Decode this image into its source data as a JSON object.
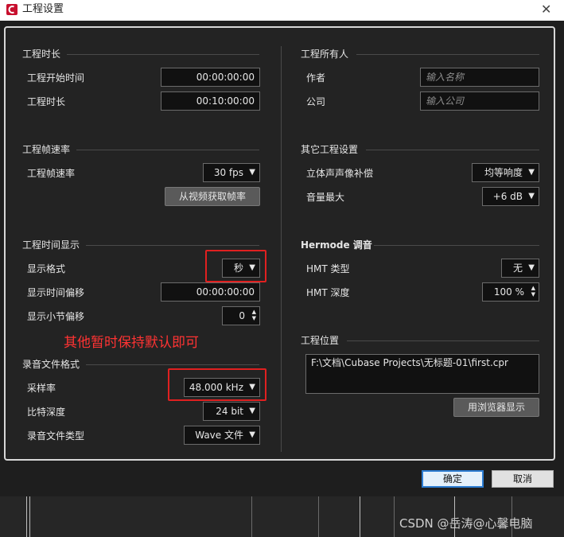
{
  "window": {
    "title": "工程设置",
    "close_glyph": "✕",
    "icon": "cubase-logo-icon"
  },
  "left": {
    "length": {
      "title": "工程时长",
      "start_label": "工程开始时间",
      "start_value": "00:00:00:00",
      "length_label": "工程时长",
      "length_value": "00:10:00:00"
    },
    "framerate": {
      "title": "工程帧速率",
      "rate_label": "工程帧速率",
      "rate_value": "30 fps",
      "from_video_button": "从视频获取帧率"
    },
    "timedisplay": {
      "title": "工程时间显示",
      "format_label": "显示格式",
      "format_value": "秒",
      "offset_label": "显示时间偏移",
      "offset_value": "00:00:00:00",
      "bar_offset_label": "显示小节偏移",
      "bar_offset_value": "0"
    },
    "record": {
      "title": "录音文件格式",
      "samplerate_label": "采样率",
      "samplerate_value": "48.000 kHz",
      "bitdepth_label": "比特深度",
      "bitdepth_value": "24 bit",
      "filetype_label": "录音文件类型",
      "filetype_value": "Wave 文件"
    }
  },
  "right": {
    "owner": {
      "title": "工程所有人",
      "author_label": "作者",
      "author_placeholder": "输入名称",
      "company_label": "公司",
      "company_placeholder": "输入公司"
    },
    "other": {
      "title": "其它工程设置",
      "pan_label": "立体声声像补偿",
      "pan_value": "均等响度",
      "volmax_label": "音量最大",
      "volmax_value": "+6 dB"
    },
    "hermode": {
      "title": "Hermode 调音",
      "type_label": "HMT 类型",
      "type_value": "无",
      "depth_label": "HMT 深度",
      "depth_value": "100 %"
    },
    "location": {
      "title": "工程位置",
      "path": "F:\\文档\\Cubase Projects\\无标题-01\\first.cpr",
      "browser_button": "用浏览器显示"
    }
  },
  "annotation": {
    "note": "其他暂时保持默认即可",
    "highlight_color": "#e02020"
  },
  "dialog": {
    "ok": "确定",
    "cancel": "取消"
  },
  "watermark": "CSDN @岳涛@心馨电脑",
  "icons": {
    "dropdown": "▼",
    "spin_up": "▲",
    "spin_down": "▼"
  }
}
